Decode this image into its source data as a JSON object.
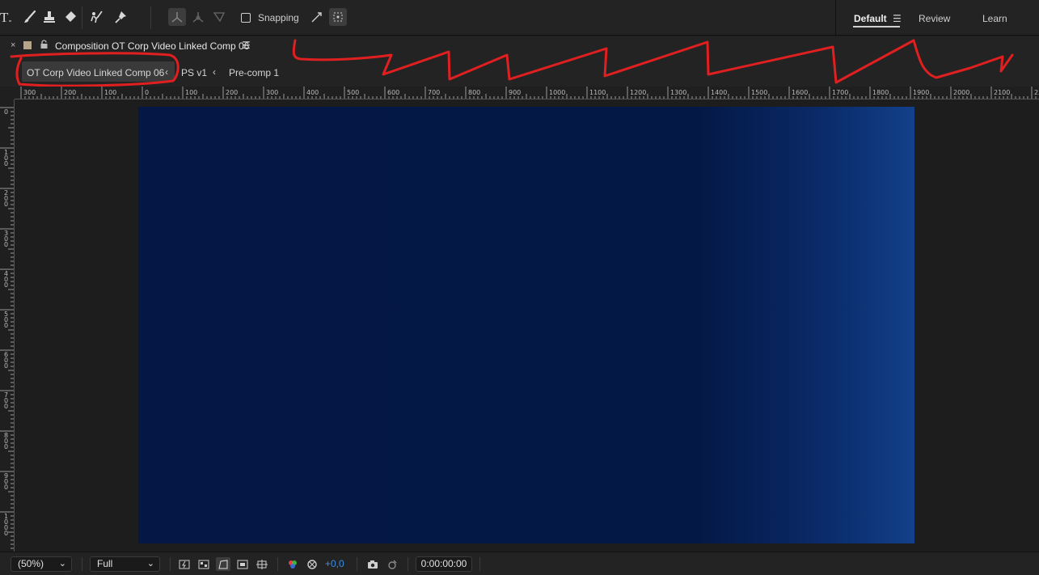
{
  "toolbar": {
    "snapping_label": "Snapping",
    "tools": [
      "type-tool",
      "brush-tool",
      "clone-stamp-tool",
      "eraser-tool",
      "roto-brush-tool",
      "puppet-pin-tool"
    ],
    "workspaces": [
      {
        "label": "Default",
        "active": true
      },
      {
        "label": "Review",
        "active": false
      },
      {
        "label": "Learn",
        "active": false
      }
    ],
    "menu_glyph": "☰"
  },
  "panel": {
    "close_glyph": "×",
    "title": "Composition OT Corp Video  Linked Comp 06",
    "menu_glyph": "☰",
    "label_color": "#b5a58a"
  },
  "breadcrumbs": [
    {
      "label": "OT Corp Video  Linked Comp 06",
      "active": true
    },
    {
      "label": "PS v1",
      "active": false
    },
    {
      "label": "Pre-comp 1",
      "active": false
    }
  ],
  "annotation_color": "#e02020",
  "ruler_top_labels": [
    "300",
    "200",
    "100",
    "0",
    "100",
    "200",
    "300",
    "400",
    "500",
    "600",
    "700",
    "800",
    "900",
    "1000",
    "1100",
    "1200",
    "1300",
    "1400",
    "1500",
    "1600",
    "1700",
    "1800",
    "1900",
    "2000",
    "2100",
    "220"
  ],
  "ruler_left_labels": [
    "0",
    "100",
    "200",
    "300",
    "400",
    "500",
    "600",
    "700",
    "800",
    "900",
    "1000"
  ],
  "bottombar": {
    "magnification": "(50%)",
    "resolution": "Full",
    "exposure": "+0,0",
    "timecode": "0:00:00:00"
  },
  "colors": {
    "canvas_base": "#051845",
    "canvas_edge": "#12408a",
    "exposure_blue": "#3d8ee6"
  }
}
